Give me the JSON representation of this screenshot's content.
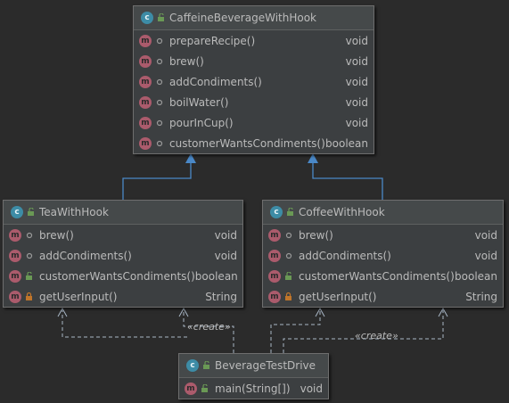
{
  "colors": {
    "background": "#2b2b2b",
    "box": "#3c3f41",
    "header": "#45494a",
    "method_badge": "#ab5b6c",
    "class_badge": "#3d8ca6",
    "inherit_arrow": "#4a88c7",
    "dependency": "#a9b7c6",
    "lock": "#c0752a",
    "public": "#6a9955"
  },
  "classes": {
    "caffeine": {
      "name": "CaffeineBeverageWithHook",
      "methods": [
        {
          "name": "prepareRecipe()",
          "type": "void",
          "icon": "circle-dot-icon"
        },
        {
          "name": "brew()",
          "type": "void",
          "icon": "circle-dot-icon"
        },
        {
          "name": "addCondiments()",
          "type": "void",
          "icon": "circle-dot-icon"
        },
        {
          "name": "boilWater()",
          "type": "void",
          "icon": "circle-dot-icon"
        },
        {
          "name": "pourInCup()",
          "type": "void",
          "icon": "circle-dot-icon"
        },
        {
          "name": "customerWantsCondiments()",
          "type": "boolean",
          "icon": "circle-dot-icon"
        }
      ]
    },
    "tea": {
      "name": "TeaWithHook",
      "methods": [
        {
          "name": "brew()",
          "type": "void",
          "icon": "circle-dot-icon"
        },
        {
          "name": "addCondiments()",
          "type": "void",
          "icon": "circle-dot-icon"
        },
        {
          "name": "customerWantsCondiments()",
          "type": "boolean",
          "icon": "unlock-icon"
        },
        {
          "name": "getUserInput()",
          "type": "String",
          "icon": "lock-icon"
        }
      ]
    },
    "coffee": {
      "name": "CoffeeWithHook",
      "methods": [
        {
          "name": "brew()",
          "type": "void",
          "icon": "circle-dot-icon"
        },
        {
          "name": "addCondiments()",
          "type": "void",
          "icon": "circle-dot-icon"
        },
        {
          "name": "customerWantsCondiments()",
          "type": "boolean",
          "icon": "unlock-icon"
        },
        {
          "name": "getUserInput()",
          "type": "String",
          "icon": "lock-icon"
        }
      ]
    },
    "driver": {
      "name": "BeverageTestDrive",
      "methods": [
        {
          "name": "main(String[])",
          "type": "void",
          "icon": "unlock-icon"
        }
      ]
    }
  },
  "relations": {
    "create_label_left": "«create»",
    "create_label_right": "«create»"
  },
  "badges": {
    "method": "m",
    "class": "c"
  }
}
